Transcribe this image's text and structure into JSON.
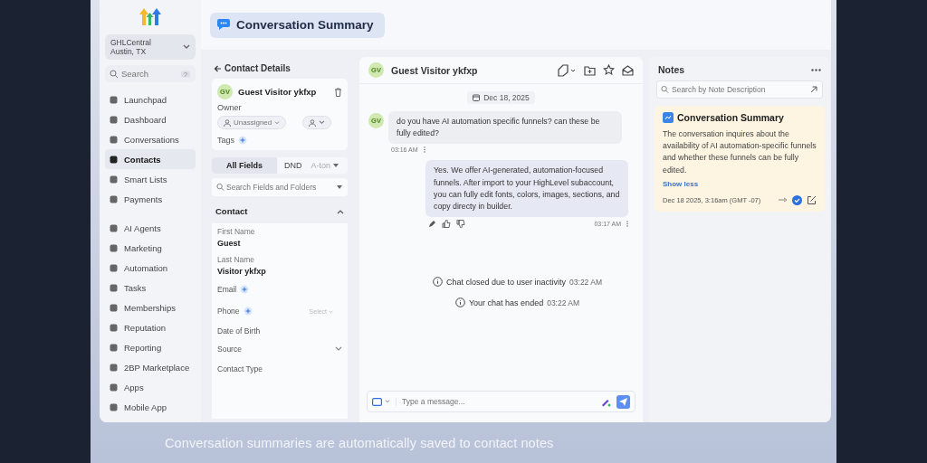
{
  "sidebar": {
    "account": {
      "name": "GHLCentral",
      "location": "Austin, TX"
    },
    "search": {
      "placeholder": "Search",
      "shortcut": "?"
    },
    "groups": [
      {
        "items": [
          {
            "label": "Launchpad",
            "selected": false
          },
          {
            "label": "Dashboard",
            "selected": false
          },
          {
            "label": "Conversations",
            "selected": false
          },
          {
            "label": "Contacts",
            "selected": true
          },
          {
            "label": "Smart Lists",
            "selected": false
          },
          {
            "label": "Payments",
            "selected": false
          }
        ]
      },
      {
        "items": [
          {
            "label": "AI Agents",
            "selected": false
          },
          {
            "label": "Marketing",
            "selected": false
          },
          {
            "label": "Automation",
            "selected": false
          },
          {
            "label": "Tasks",
            "selected": false
          },
          {
            "label": "Memberships",
            "selected": false
          },
          {
            "label": "Reputation",
            "selected": false
          },
          {
            "label": "Reporting",
            "selected": false
          },
          {
            "label": "2BP Marketplace",
            "selected": false
          },
          {
            "label": "Apps",
            "selected": false
          },
          {
            "label": "Mobile App",
            "selected": false
          }
        ]
      }
    ]
  },
  "header": {
    "title": "Conversation Summary"
  },
  "contact_details": {
    "title": "Contact Details",
    "contact": {
      "initials": "GV",
      "name": "Guest Visitor ykfxp"
    },
    "owner_label": "Owner",
    "owner_value": "Unassigned",
    "tags_label": "Tags",
    "tabs": [
      {
        "label": "All Fields",
        "selected": true
      },
      {
        "label": "DND",
        "selected": false
      },
      {
        "label": "A-ton",
        "selected": false
      }
    ],
    "search": {
      "placeholder": "Search Fields and Folders"
    },
    "section": {
      "title": "Contact",
      "expanded": true
    },
    "fields": [
      {
        "kind": "value",
        "label": "First Name",
        "value": "Guest"
      },
      {
        "kind": "value",
        "label": "Last Name",
        "value": "Visitor ykfxp"
      },
      {
        "kind": "add",
        "label": "Email"
      },
      {
        "kind": "add",
        "label": "Phone",
        "select": "Select"
      },
      {
        "kind": "label",
        "label": "Date of Birth"
      },
      {
        "kind": "dropdown",
        "label": "Source"
      },
      {
        "kind": "label",
        "label": "Contact Type"
      }
    ]
  },
  "chat": {
    "header": {
      "initials": "GV",
      "name": "Guest Visitor ykfxp"
    },
    "date": "Dec 18, 2025",
    "messages": [
      {
        "kind": "inbound",
        "initials": "GV",
        "text": "do you have AI automation specific funnels? can these be fully edited?",
        "time": "03:16 AM"
      },
      {
        "kind": "outbound",
        "text": "Yes. We offer AI-generated, automation-focused funnels. After import to your HighLevel subaccount, you can fully edit fonts, colors, images, sections, and copy directy in builder.",
        "time": "03:17 AM"
      }
    ],
    "events": [
      {
        "text": "Chat closed due to user inactivity",
        "time": "03:22 AM"
      },
      {
        "text": "Your chat has ended",
        "time": "03:22 AM"
      }
    ],
    "composer": {
      "placeholder": "Type a message..."
    }
  },
  "notes": {
    "title": "Notes",
    "search": {
      "placeholder": "Search by Note Description"
    },
    "note": {
      "title": "Conversation Summary",
      "body": "The conversation inquires about the availability of AI automation-specific funnels and whether these funnels can be fully edited.",
      "toggle": "Show less",
      "meta": "Dec 18 2025, 3:16am (GMT -07)"
    }
  },
  "caption": "Conversation summaries are automatically saved to contact notes"
}
